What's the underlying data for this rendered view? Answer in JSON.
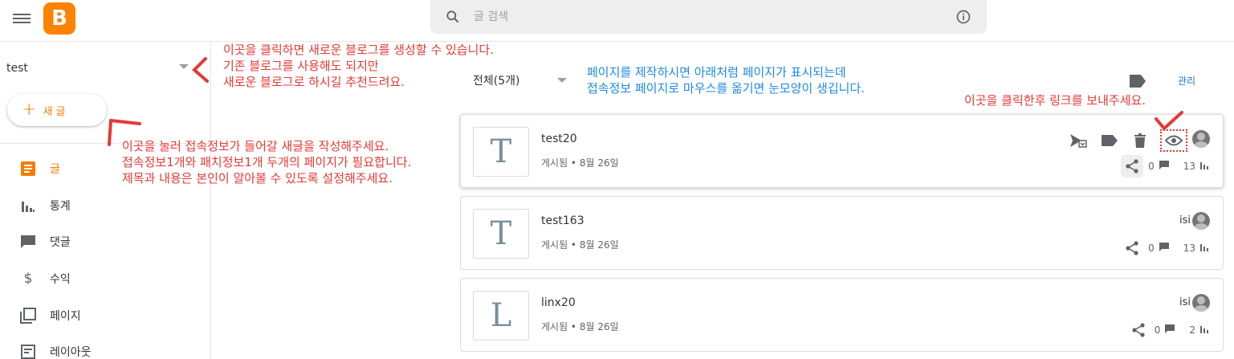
{
  "header": {
    "logo_letter": "B",
    "search_placeholder": "글 검색"
  },
  "sidebar": {
    "blog_name": "test",
    "new_post_label": "새 글",
    "items": [
      {
        "label": "글",
        "icon": "posts-icon",
        "active": true
      },
      {
        "label": "통계",
        "icon": "stats-icon",
        "active": false
      },
      {
        "label": "댓글",
        "icon": "comment-icon",
        "active": false
      },
      {
        "label": "수익",
        "icon": "dollar-icon",
        "active": false
      },
      {
        "label": "페이지",
        "icon": "pages-icon",
        "active": false
      },
      {
        "label": "레이아웃",
        "icon": "layout-icon",
        "active": false
      }
    ]
  },
  "main": {
    "filter_label": "전체(5개)",
    "manage_label": "관리",
    "posts": [
      {
        "letter": "T",
        "title": "test20",
        "meta": "게시됨 • 8월 26일",
        "author": "",
        "comments": "0",
        "views": "13"
      },
      {
        "letter": "T",
        "title": "test163",
        "meta": "게시됨 • 8월 26일",
        "author": "isi",
        "comments": "0",
        "views": "13"
      },
      {
        "letter": "L",
        "title": "linx20",
        "meta": "게시됨 • 8월 26일",
        "author": "isi",
        "comments": "0",
        "views": "2"
      }
    ]
  },
  "annotations": {
    "create_blog": [
      "이곳을 클릭하면 새로운 블로그를 생성할 수 있습니다.",
      "기존 블로그를 사용해도 되지만",
      "새로운 블로그로 하시길 추천드려요."
    ],
    "new_post": [
      "이곳을 눌러 접속정보가 들어갈 새글을 작성해주세요.",
      "접속정보1개와 패치정보1개 두개의 페이지가 필요합니다.",
      "제목과 내용은 본인이 알아볼 수 있도록 설정해주세요."
    ],
    "page_note": [
      "페이지를 제작하시면 아래처럼 페이지가 표시되는데",
      "접속정보 페이지로 마우스를 옮기면 눈모양이 생깁니다."
    ],
    "click_link": "이곳을 클릭한후 링크를 보내주세요."
  },
  "colors": {
    "accent": "#f57c00",
    "annotation_red": "#e53935",
    "annotation_blue": "#1e88e5"
  }
}
